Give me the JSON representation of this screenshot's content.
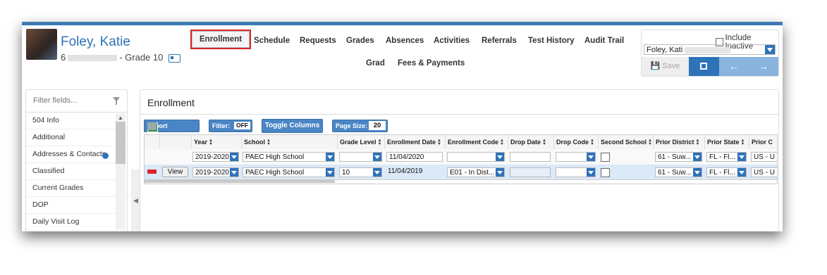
{
  "student": {
    "name": "Foley, Katie",
    "id_prefix": "6",
    "grade_text": "- Grade 10"
  },
  "nav": {
    "tabs_row1": [
      "Enrollment",
      "Schedule",
      "Requests",
      "Grades",
      "Absences",
      "Activities",
      "Referrals",
      "Test History",
      "Audit Trail"
    ],
    "tabs_row2": [
      "Grad",
      "Fees & Payments"
    ],
    "active_tab": "Enrollment"
  },
  "student_selector": {
    "include_inactive_label": "Include Inactive",
    "selected_value": "Foley, Kati",
    "save_label": "Save",
    "prev_icon": "left-arrow-icon",
    "next_icon": "right-arrow-icon",
    "print_icon": "print-icon"
  },
  "sidebar": {
    "filter_placeholder": "Filter fields...",
    "items": [
      "504 Info",
      "Additional",
      "Addresses & Contacts",
      "Classified",
      "Current Grades",
      "DOP",
      "Daily Visit Log"
    ]
  },
  "main": {
    "title": "Enrollment",
    "toolbar": {
      "export_label": "Export",
      "filter_label": "Filter:",
      "filter_state": "OFF",
      "toggle_columns_label": "Toggle Columns",
      "page_size_label": "Page Size:",
      "page_size_value": "20"
    },
    "columns": [
      "Year",
      "School",
      "Grade Level",
      "Enrollment Date",
      "Enrollment Code",
      "Drop Date",
      "Drop Code",
      "Second School",
      "Prior District",
      "Prior State",
      "Prior C"
    ],
    "filter_row": {
      "year": "2019-2020",
      "school": "PAEC High School",
      "grade_level": "",
      "enrollment_date": "11/04/2020",
      "enrollment_code": "",
      "drop_date": "",
      "drop_code": "",
      "prior_district": "61 - Suw...",
      "prior_state": "FL - Fl...",
      "prior_country": "US - U"
    },
    "data_row": {
      "view_label": "View",
      "year": "2019-2020",
      "school": "PAEC High School",
      "grade_level": "10",
      "enrollment_date": "11/04/2019",
      "enrollment_code": "E01 - In Dist...",
      "drop_date": "",
      "drop_code": "",
      "prior_district": "61 - Suw...",
      "prior_state": "FL - Fl...",
      "prior_country": "US - U"
    }
  }
}
